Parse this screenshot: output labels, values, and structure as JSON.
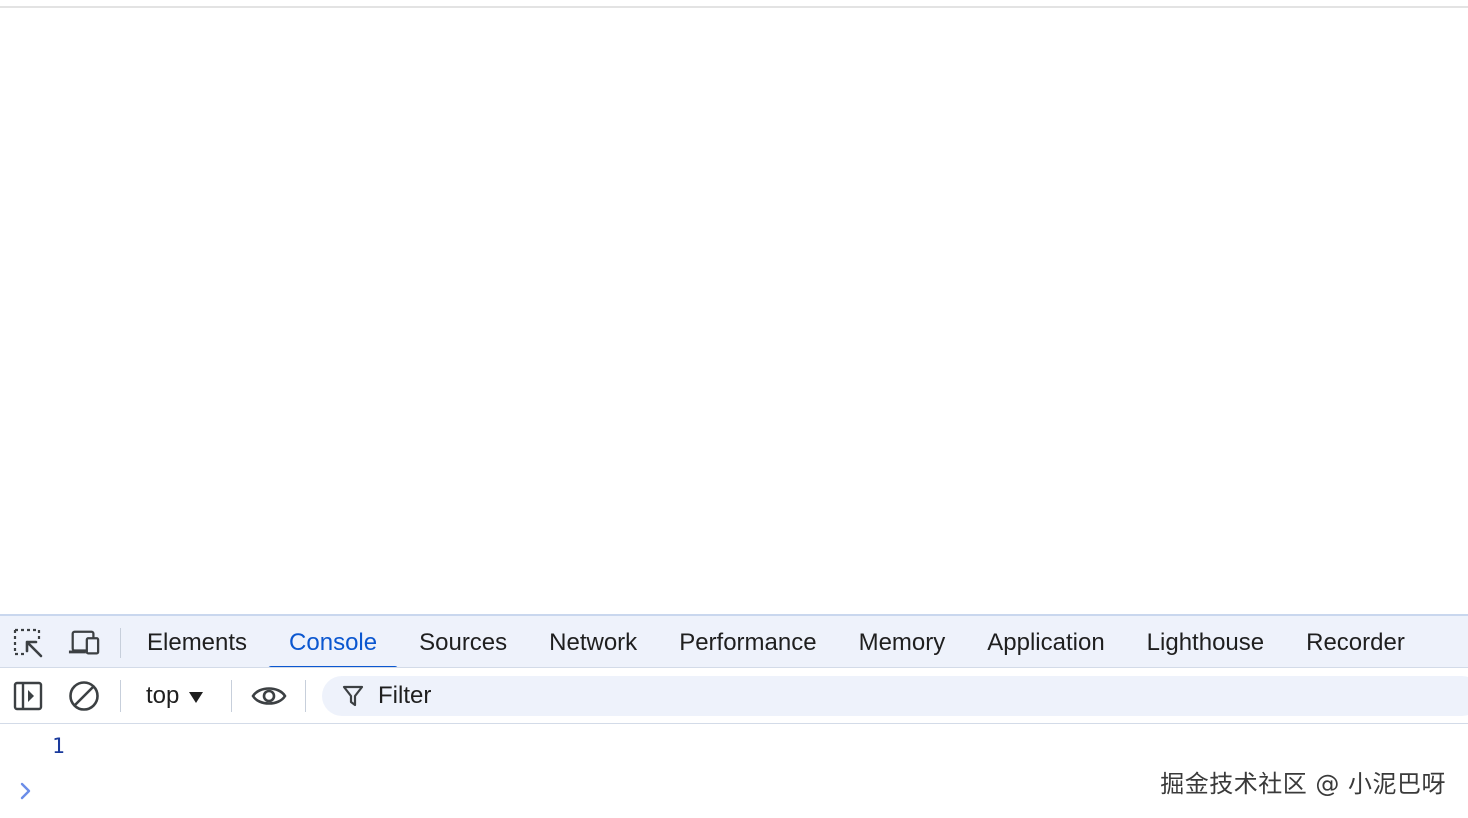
{
  "devtools": {
    "tabs": [
      {
        "label": "Elements",
        "active": false
      },
      {
        "label": "Console",
        "active": true
      },
      {
        "label": "Sources",
        "active": false
      },
      {
        "label": "Network",
        "active": false
      },
      {
        "label": "Performance",
        "active": false
      },
      {
        "label": "Memory",
        "active": false
      },
      {
        "label": "Application",
        "active": false
      },
      {
        "label": "Lighthouse",
        "active": false
      },
      {
        "label": "Recorder",
        "active": false
      }
    ],
    "icons": {
      "inspect": "inspect-element-icon",
      "device": "device-toolbar-icon",
      "sidebar": "sidebar-toggle-icon",
      "clear": "clear-console-icon",
      "eye": "live-expression-icon",
      "filter": "filter-icon",
      "prompt": "console-prompt-chevron-icon"
    },
    "colors": {
      "accent": "#0b57d0",
      "tabbar_bg": "#eef2fb",
      "log_value": "#1a3a9c"
    }
  },
  "console": {
    "context": "top",
    "filter_placeholder": "Filter",
    "logs": [
      "1"
    ]
  },
  "watermark": "掘金技术社区 @ 小泥巴呀"
}
